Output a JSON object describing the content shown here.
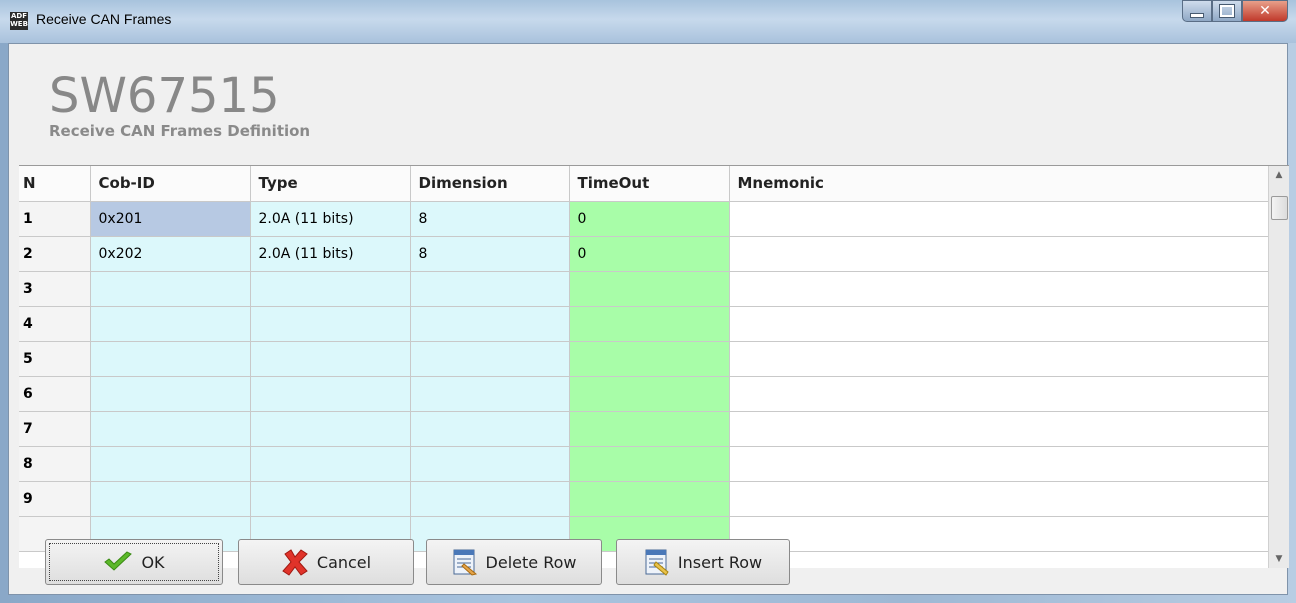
{
  "window": {
    "title": "Receive CAN Frames",
    "icon_text": "ADF WEB"
  },
  "header": {
    "title": "SW67515",
    "subtitle": "Receive CAN Frames Definition"
  },
  "grid": {
    "columns": [
      "N",
      "Cob-ID",
      "Type",
      "Dimension",
      "TimeOut",
      "Mnemonic"
    ],
    "rows": [
      [
        "1",
        "0x201",
        "2.0A (11 bits)",
        "8",
        "0",
        ""
      ],
      [
        "2",
        "0x202",
        "2.0A (11 bits)",
        "8",
        "0",
        ""
      ],
      [
        "3",
        "",
        "",
        "",
        "",
        ""
      ],
      [
        "4",
        "",
        "",
        "",
        "",
        ""
      ],
      [
        "5",
        "",
        "",
        "",
        "",
        ""
      ],
      [
        "6",
        "",
        "",
        "",
        "",
        ""
      ],
      [
        "7",
        "",
        "",
        "",
        "",
        ""
      ],
      [
        "8",
        "",
        "",
        "",
        "",
        ""
      ],
      [
        "9",
        "",
        "",
        "",
        "",
        ""
      ],
      [
        "",
        "",
        "",
        "",
        "",
        ""
      ]
    ]
  },
  "buttons": {
    "ok": "OK",
    "cancel": "Cancel",
    "delete_row": "Delete Row",
    "insert_row": "Insert Row"
  }
}
